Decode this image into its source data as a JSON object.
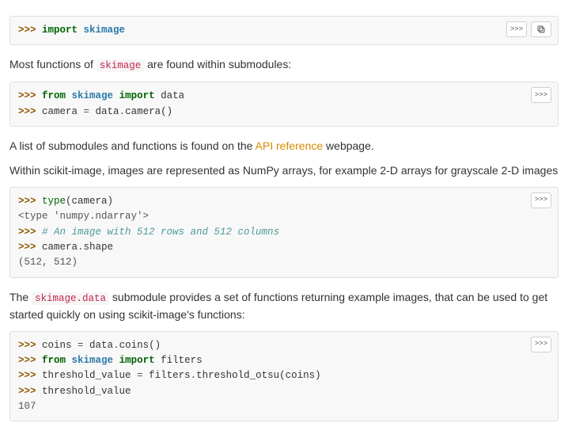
{
  "blocks": [
    {
      "tools": {
        "prompt_label": ">>>",
        "show_copy": true
      },
      "lines": [
        {
          "tokens": [
            {
              "cls": "gp",
              "t": ">>> "
            },
            {
              "cls": "kn",
              "t": "import"
            },
            {
              "cls": "n",
              "t": " "
            },
            {
              "cls": "nn",
              "t": "skimage"
            }
          ]
        }
      ]
    },
    {
      "tools": {
        "prompt_label": ">>>",
        "show_copy": false
      },
      "lines": [
        {
          "tokens": [
            {
              "cls": "gp",
              "t": ">>> "
            },
            {
              "cls": "kn",
              "t": "from"
            },
            {
              "cls": "n",
              "t": " "
            },
            {
              "cls": "nn",
              "t": "skimage"
            },
            {
              "cls": "n",
              "t": " "
            },
            {
              "cls": "kn",
              "t": "import"
            },
            {
              "cls": "n",
              "t": " data"
            }
          ]
        },
        {
          "tokens": [
            {
              "cls": "gp",
              "t": ">>> "
            },
            {
              "cls": "n",
              "t": "camera "
            },
            {
              "cls": "op",
              "t": "="
            },
            {
              "cls": "n",
              "t": " data"
            },
            {
              "cls": "op",
              "t": "."
            },
            {
              "cls": "n",
              "t": "camera()"
            }
          ]
        }
      ]
    },
    {
      "tools": {
        "prompt_label": ">>>",
        "show_copy": false
      },
      "lines": [
        {
          "tokens": [
            {
              "cls": "gp",
              "t": ">>> "
            },
            {
              "cls": "nb",
              "t": "type"
            },
            {
              "cls": "n",
              "t": "(camera)"
            }
          ]
        },
        {
          "tokens": [
            {
              "cls": "go",
              "t": "<type 'numpy.ndarray'>"
            }
          ]
        },
        {
          "tokens": [
            {
              "cls": "gp",
              "t": ">>> "
            },
            {
              "cls": "c1",
              "t": "# An image with 512 rows and 512 columns"
            }
          ]
        },
        {
          "tokens": [
            {
              "cls": "gp",
              "t": ">>> "
            },
            {
              "cls": "n",
              "t": "camera"
            },
            {
              "cls": "op",
              "t": "."
            },
            {
              "cls": "n",
              "t": "shape"
            }
          ]
        },
        {
          "tokens": [
            {
              "cls": "go",
              "t": "(512, 512)"
            }
          ]
        }
      ]
    },
    {
      "tools": {
        "prompt_label": ">>>",
        "show_copy": false
      },
      "lines": [
        {
          "tokens": [
            {
              "cls": "gp",
              "t": ">>> "
            },
            {
              "cls": "n",
              "t": "coins "
            },
            {
              "cls": "op",
              "t": "="
            },
            {
              "cls": "n",
              "t": " data"
            },
            {
              "cls": "op",
              "t": "."
            },
            {
              "cls": "n",
              "t": "coins()"
            }
          ]
        },
        {
          "tokens": [
            {
              "cls": "gp",
              "t": ">>> "
            },
            {
              "cls": "kn",
              "t": "from"
            },
            {
              "cls": "n",
              "t": " "
            },
            {
              "cls": "nn",
              "t": "skimage"
            },
            {
              "cls": "n",
              "t": " "
            },
            {
              "cls": "kn",
              "t": "import"
            },
            {
              "cls": "n",
              "t": " filters"
            }
          ]
        },
        {
          "tokens": [
            {
              "cls": "gp",
              "t": ">>> "
            },
            {
              "cls": "n",
              "t": "threshold_value "
            },
            {
              "cls": "op",
              "t": "="
            },
            {
              "cls": "n",
              "t": " filters"
            },
            {
              "cls": "op",
              "t": "."
            },
            {
              "cls": "n",
              "t": "threshold_otsu(coins)"
            }
          ]
        },
        {
          "tokens": [
            {
              "cls": "gp",
              "t": ">>> "
            },
            {
              "cls": "n",
              "t": "threshold_value"
            }
          ]
        },
        {
          "tokens": [
            {
              "cls": "go",
              "t": "107"
            }
          ]
        }
      ]
    }
  ],
  "prose": {
    "p1_a": "Most functions of ",
    "p1_code": "skimage",
    "p1_b": " are found within submodules:",
    "p2_a": "A list of submodules and functions is found on the ",
    "p2_link": "API reference",
    "p2_b": " webpage.",
    "p3": "Within scikit-image, images are represented as NumPy arrays, for example 2-D arrays for grayscale 2-D images",
    "p4_a": "The ",
    "p4_code": "skimage.data",
    "p4_b": " submodule provides a set of functions returning example images, that can be used to get started quickly on using scikit-image's functions:"
  }
}
